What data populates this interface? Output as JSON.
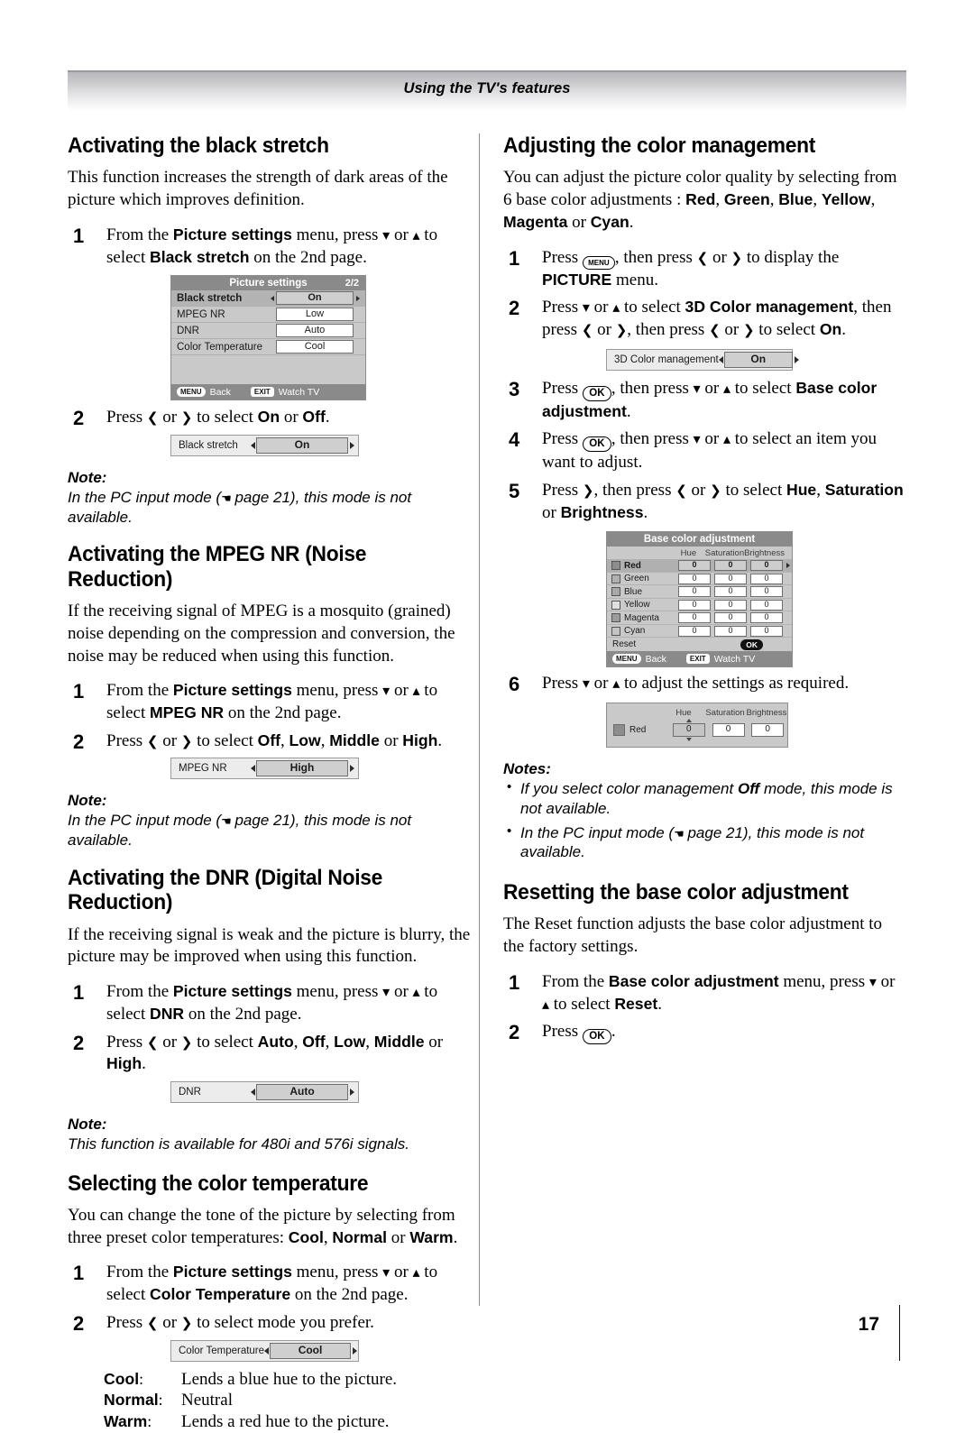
{
  "header": {
    "title": "Using the TV's features"
  },
  "page_number": "17",
  "left": {
    "s1": {
      "heading": "Activating the black stretch",
      "intro": "This function increases the strength of dark areas of the picture which improves definition.",
      "step1_a": "From the ",
      "step1_b": "Picture settings",
      "step1_c": " menu, press ",
      "step1_d": " or ",
      "step1_e": " to select ",
      "step1_f": "Black stretch",
      "step1_g": " on the 2nd page.",
      "step2_a": "Press ",
      "step2_b": " or ",
      "step2_c": " to select ",
      "step2_d": "On",
      "step2_e": " or ",
      "step2_f": "Off",
      "step2_g": ".",
      "num1": "1",
      "num2": "2",
      "note_label": "Note:",
      "note_a": "In the PC input mode (",
      "note_b": " page 21), this mode is not available.",
      "osd": {
        "title": "Picture settings",
        "page": "2/2",
        "rows": [
          {
            "label": "Black stretch",
            "value": "On",
            "selected": true
          },
          {
            "label": "MPEG NR",
            "value": "Low",
            "selected": false
          },
          {
            "label": "DNR",
            "value": "Auto",
            "selected": false
          },
          {
            "label": "Color Temperature",
            "value": "Cool",
            "selected": false
          }
        ],
        "foot_menu": "MENU",
        "foot_menu_label": "Back",
        "foot_exit": "EXIT",
        "foot_exit_label": "Watch TV"
      },
      "bar": {
        "label": "Black stretch",
        "value": "On"
      }
    },
    "s2": {
      "heading": "Activating the MPEG NR (Noise Reduction)",
      "intro": "If the receiving signal of MPEG is a mosquito (grained) noise depending on the compression and conversion, the noise may be reduced when using this function.",
      "num1": "1",
      "num2": "2",
      "step1_a": "From the ",
      "step1_b": "Picture settings",
      "step1_c": " menu, press ",
      "step1_d": " or ",
      "step1_e": " to select ",
      "step1_f": "MPEG NR",
      "step1_g": " on the 2nd page.",
      "step2_a": "Press ",
      "step2_b": " or ",
      "step2_c": " to select ",
      "opt1": "Off",
      "opt2": "Low",
      "opt3": "Middle",
      "opt4": "High",
      "sep1": ", ",
      "sep2": ", ",
      "sep3": " or ",
      "end": ".",
      "note_label": "Note:",
      "note_a": "In the PC input mode (",
      "note_b": " page 21), this mode is not available.",
      "bar": {
        "label": "MPEG NR",
        "value": "High"
      }
    },
    "s3": {
      "heading": "Activating the DNR (Digital Noise Reduction)",
      "intro": "If the receiving signal is weak and the picture is blurry, the picture may be improved when using this function.",
      "num1": "1",
      "num2": "2",
      "step1_a": "From the ",
      "step1_b": "Picture settings",
      "step1_c": " menu, press ",
      "step1_d": " or ",
      "step1_e": " to select ",
      "step1_f": "DNR",
      "step1_g": " on the 2nd page.",
      "step2_a": "Press ",
      "step2_b": " or ",
      "step2_c": " to select ",
      "opt1": "Auto",
      "opt2": "Off",
      "opt3": "Low",
      "opt4": "Middle",
      "opt5": "High",
      "sep": ", ",
      "sep_or": " or ",
      "end": ".",
      "note_label": "Note:",
      "note_text": "This function is available for 480i and 576i signals.",
      "bar": {
        "label": "DNR",
        "value": "Auto"
      }
    },
    "s4": {
      "heading": "Selecting the color temperature",
      "intro_a": "You can change the tone of the picture by selecting from three preset color temperatures: ",
      "opt1": "Cool",
      "opt2": "Normal",
      "opt3": "Warm",
      "sep": ", ",
      "sep_or": " or ",
      "end": ".",
      "num1": "1",
      "num2": "2",
      "step1_a": "From the ",
      "step1_b": "Picture settings",
      "step1_c": " menu, press ",
      "step1_d": " or ",
      "step1_e": " to select ",
      "step1_f": "Color Temperature",
      "step1_g": " on the 2nd page.",
      "step2_a": "Press ",
      "step2_b": " or ",
      "step2_c": " to select mode you prefer.",
      "bar": {
        "label": "Color Temperature",
        "value": "Cool"
      },
      "defs": [
        {
          "term": "Cool",
          "desc": "Lends a blue hue to the picture."
        },
        {
          "term": "Normal",
          "desc": "Neutral"
        },
        {
          "term": "Warm",
          "desc": "Lends a red hue to the picture."
        }
      ]
    }
  },
  "right": {
    "s1": {
      "heading": "Adjusting the color management",
      "intro_a": "You can adjust the picture color quality by selecting from 6 base color adjustments : ",
      "c1": "Red",
      "c2": "Green",
      "c3": "Blue",
      "c4": "Yellow",
      "c5": "Magenta",
      "c6": "Cyan",
      "sep": ", ",
      "sep_or": " or ",
      "end": ".",
      "num1": "1",
      "num2": "2",
      "num3": "3",
      "num4": "4",
      "num5": "5",
      "num6": "6",
      "key_menu": "MENU",
      "key_ok": "OK",
      "step1_a": "Press ",
      "step1_b": ", then press ",
      "step1_c": " or ",
      "step1_d": " to display the ",
      "step1_e": "PICTURE",
      "step1_f": " menu.",
      "step2_a": "Press ",
      "step2_b": " or ",
      "step2_c": " to select ",
      "step2_d": "3D Color management",
      "step2_e": ", then press ",
      "step2_f": " or ",
      "step2_g": ", then press ",
      "step2_h": " or ",
      "step2_i": " to select ",
      "step2_j": "On",
      "step2_k": ".",
      "bar": {
        "label": "3D Color management",
        "value": "On"
      },
      "step3_a": "Press ",
      "step3_b": ", then press ",
      "step3_c": " or ",
      "step3_d": " to select ",
      "step3_e": "Base color adjustment",
      "step3_f": ".",
      "step4_a": "Press ",
      "step4_b": ", then press ",
      "step4_c": " or ",
      "step4_d": " to select an item you want to adjust.",
      "step5_a": "Press ",
      "step5_b": ", then press ",
      "step5_c": " or ",
      "step5_d": " to select ",
      "step5_e": "Hue",
      "step5_f": ", ",
      "step5_g": "Saturation",
      "step5_h": " or ",
      "step5_i": "Brightness",
      "step5_j": ".",
      "step6_a": "Press ",
      "step6_b": " or ",
      "step6_c": " to adjust the settings as required.",
      "bca": {
        "title": "Base color adjustment",
        "col_name": "",
        "col_hue": "Hue",
        "col_sat": "Saturation",
        "col_bri": "Brightness",
        "rows": [
          {
            "name": "Red",
            "swatch": "#8d8d8d",
            "hue": "0",
            "sat": "0",
            "bri": "0",
            "selected": true
          },
          {
            "name": "Green",
            "swatch": "#b0b0b0",
            "hue": "0",
            "sat": "0",
            "bri": "0",
            "selected": false
          },
          {
            "name": "Blue",
            "swatch": "#a8a8a8",
            "hue": "0",
            "sat": "0",
            "bri": "0",
            "selected": false
          },
          {
            "name": "Yellow",
            "swatch": "#e0e0e0",
            "hue": "0",
            "sat": "0",
            "bri": "0",
            "selected": false
          },
          {
            "name": "Magenta",
            "swatch": "#9c9c9c",
            "hue": "0",
            "sat": "0",
            "bri": "0",
            "selected": false
          },
          {
            "name": "Cyan",
            "swatch": "#c4c4c4",
            "hue": "0",
            "sat": "0",
            "bri": "0",
            "selected": false
          }
        ],
        "reset_label": "Reset",
        "reset_ok": "OK",
        "foot_menu": "MENU",
        "foot_menu_label": "Back",
        "foot_exit": "EXIT",
        "foot_exit_label": "Watch TV"
      },
      "hsb": {
        "col_hue": "Hue",
        "col_sat": "Saturation",
        "col_bri": "Brightness",
        "row_name": "Red",
        "hue": "0",
        "sat": "0",
        "bri": "0"
      },
      "notes_label": "Notes:",
      "note1_a": "If you select color management ",
      "note1_b": "Off",
      "note1_c": " mode, this mode is not available.",
      "note2_a": "In the PC input mode (",
      "note2_b": " page 21), this mode is not available."
    },
    "s2": {
      "heading": "Resetting the base color adjustment",
      "intro": "The Reset function adjusts the base color adjustment to the factory settings.",
      "num1": "1",
      "num2": "2",
      "step1_a": "From the ",
      "step1_b": "Base color adjustment",
      "step1_c": " menu, press ",
      "step1_d": " or ",
      "step1_e": " to select ",
      "step1_f": "Reset",
      "step1_g": ".",
      "step2_a": "Press ",
      "step2_b": "OK",
      "step2_c": "."
    }
  }
}
